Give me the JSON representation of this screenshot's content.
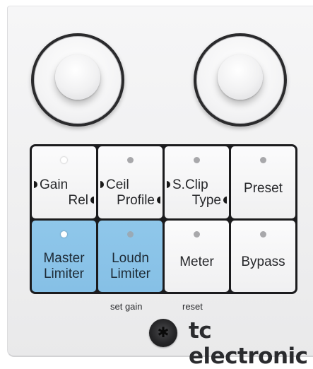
{
  "knobs": [
    {
      "name": "left-knob"
    },
    {
      "name": "right-knob"
    }
  ],
  "buttons": {
    "gain_rel": {
      "line1": "Gain",
      "line2": "Rel",
      "led_on": true
    },
    "ceil_profile": {
      "line1": "Ceil",
      "line2": "Profile",
      "led_on": false
    },
    "sclip_type": {
      "line1": "S.Clip",
      "line2": "Type",
      "led_on": false
    },
    "preset": {
      "label": "Preset",
      "led_on": false
    },
    "master_limiter": {
      "line1": "Master",
      "line2": "Limiter",
      "led_on": true,
      "color": "#8fc7ea"
    },
    "loudn_limiter": {
      "line1": "Loudn",
      "line2": "Limiter",
      "led_on": false,
      "color": "#8fc7ea"
    },
    "meter": {
      "label": "Meter",
      "led_on": false
    },
    "bypass": {
      "label": "Bypass",
      "led_on": false
    }
  },
  "sublabels": {
    "set_gain": "set gain",
    "reset": "reset"
  },
  "brand": {
    "text": "tc electronic"
  }
}
